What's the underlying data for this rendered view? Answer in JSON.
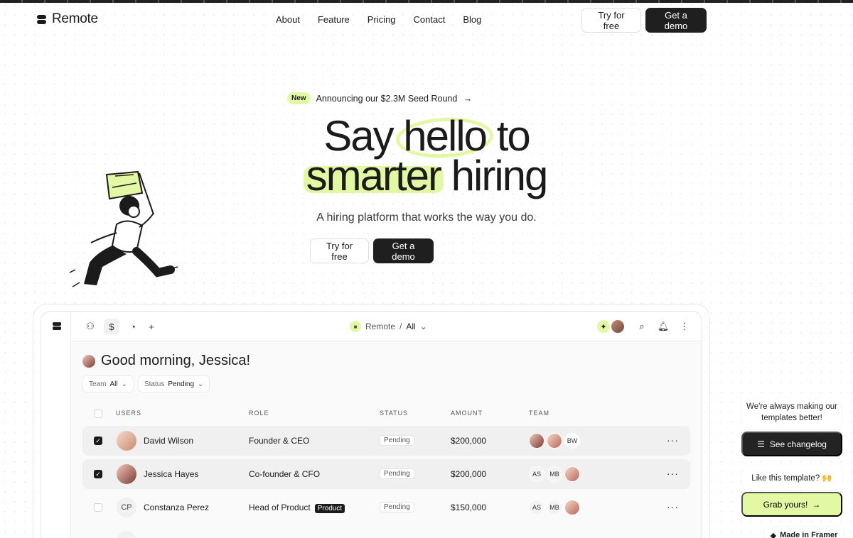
{
  "brand": {
    "name": "Remote"
  },
  "nav": {
    "links": [
      "About",
      "Feature",
      "Pricing",
      "Contact",
      "Blog"
    ],
    "try_label": "Try for free",
    "demo_label": "Get a demo"
  },
  "hero": {
    "badge": "New",
    "announcement": "Announcing our $2.3M Seed Round",
    "title_say": "Say",
    "title_hello": "hello",
    "title_to": "to",
    "title_smarter": "smarter",
    "title_hiring": "hiring",
    "subtitle": "A hiring platform that works the way you do.",
    "try_label": "Try for free",
    "demo_label": "Get a demo"
  },
  "app": {
    "workspace": "Remote",
    "separator": "/",
    "scope": "All",
    "greeting": "Good morning, Jessica!",
    "filters": [
      {
        "label": "Team",
        "value": "All"
      },
      {
        "label": "Status",
        "value": "Pending"
      }
    ],
    "columns": [
      "USERS",
      "ROLE",
      "STATUS",
      "AMOUNT",
      "TEAM"
    ],
    "rows": [
      {
        "name": "David Wilson",
        "role": "Founder & CEO",
        "tag": "",
        "status": "Pending",
        "amount": "$200,000",
        "initials": "",
        "team": [
          "",
          "",
          "BW"
        ],
        "selected": true
      },
      {
        "name": "Jessica Hayes",
        "role": "Co-founder & CFO",
        "tag": "",
        "status": "Pending",
        "amount": "$200,000",
        "initials": "",
        "team": [
          "AS",
          "MB",
          ""
        ],
        "selected": true
      },
      {
        "name": "Constanza Perez",
        "role": "Head of Product",
        "tag": "Product",
        "status": "Pending",
        "amount": "$150,000",
        "initials": "CP",
        "team": [
          "AS",
          "MB",
          ""
        ],
        "selected": false
      }
    ]
  },
  "floating": {
    "note": "We're always making our templates better!",
    "changelog": "See changelog",
    "like": "Like this template? 🙌",
    "grab": "Grab yours!",
    "grab_arrow": "→",
    "framer": "Made in Framer"
  },
  "colors": {
    "accent": "#e2f8a2",
    "dark": "#1f1f1f"
  }
}
